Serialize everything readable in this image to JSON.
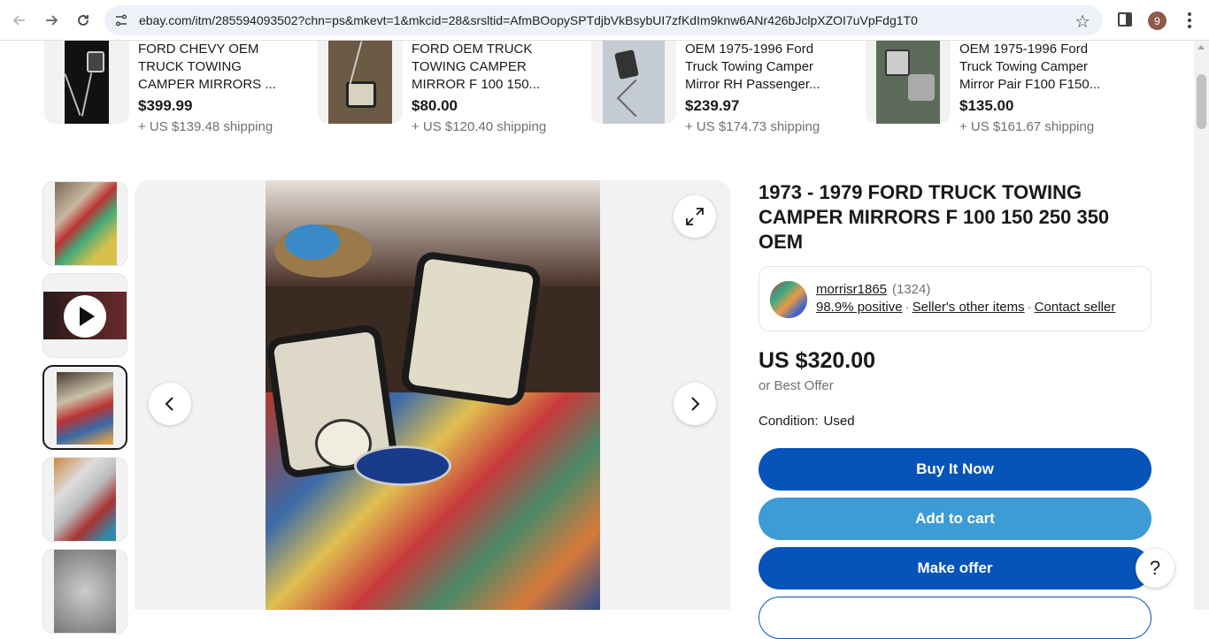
{
  "browser": {
    "url": "ebay.com/itm/285594093502?chn=ps&mkevt=1&mkcid=28&srsltid=AfmBOopySPTdjbVkBsybUI7zfKdIm9knw6ANr426bJclpXZOI7uVpFdg1T0",
    "profile_initial": "9"
  },
  "similar_items": [
    {
      "title": "FORD CHEVY OEM TRUCK TOWING CAMPER MIRRORS ...",
      "price": "$399.99",
      "shipping": "+ US $139.48 shipping"
    },
    {
      "title": "FORD OEM TRUCK TOWING CAMPER MIRROR F 100 150...",
      "price": "$80.00",
      "shipping": "+ US $120.40 shipping"
    },
    {
      "title": "OEM 1975-1996 Ford Truck Towing Camper Mirror RH Passenger...",
      "price": "$239.97",
      "shipping": "+ US $174.73 shipping"
    },
    {
      "title": "OEM 1975-1996 Ford Truck Towing Camper Mirror Pair F100 F150...",
      "price": "$135.00",
      "shipping": "+ US $161.67 shipping"
    }
  ],
  "listing": {
    "title": "1973 - 1979 FORD TRUCK TOWING CAMPER MIRRORS F 100 150 250 350 OEM",
    "seller": {
      "name": "morrisr1865",
      "count": "(1324)",
      "positive": "98.9% positive",
      "other_items": "Seller's other items",
      "contact": "Contact seller"
    },
    "price": "US $320.00",
    "best_offer": "or Best Offer",
    "condition_label": "Condition:",
    "condition_value": "Used",
    "buttons": {
      "buy": "Buy It Now",
      "cart": "Add to cart",
      "offer": "Make offer"
    }
  },
  "help_label": "?",
  "icons": {
    "back": "arrow-left-icon",
    "forward": "arrow-right-icon",
    "reload": "reload-icon",
    "site_settings": "tune-icon",
    "bookmark": "star-icon",
    "expand": "expand-icon",
    "prev": "chevron-left-icon",
    "next": "chevron-right-icon",
    "play": "play-icon"
  },
  "colors": {
    "primary_button": "#0654ba",
    "secondary_button": "#3d9bd6",
    "text": "#191919",
    "muted": "#707070"
  }
}
